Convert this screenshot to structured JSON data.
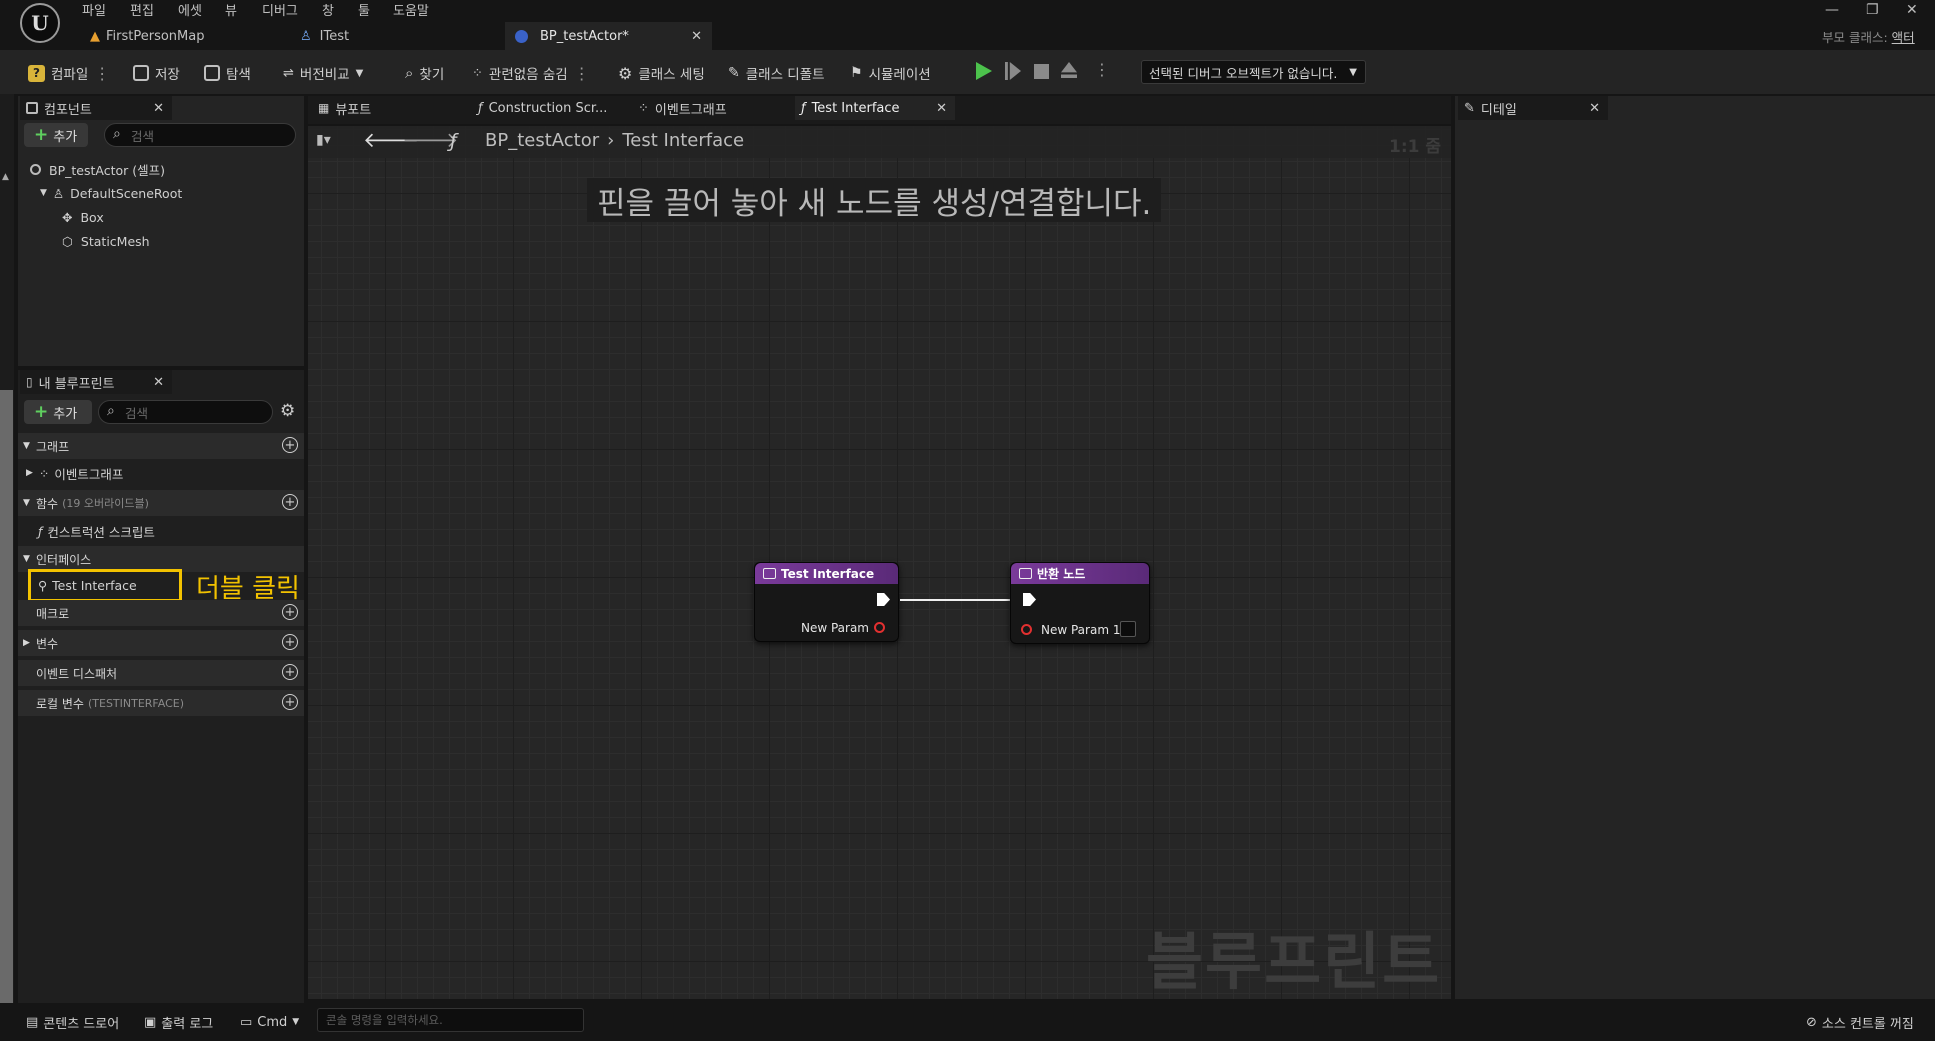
{
  "menu": [
    "파일",
    "편집",
    "에셋",
    "뷰",
    "디버그",
    "창",
    "툴",
    "도움말"
  ],
  "doc_tabs": [
    "FirstPersonMap",
    "ITest",
    "BP_testActor*"
  ],
  "parent_class": {
    "label": "부모 클래스:",
    "value": "액터"
  },
  "toolbar": {
    "compile": "컴파일",
    "save": "저장",
    "browse": "탐색",
    "diff": "버전비교",
    "find": "찾기",
    "hide_unrelated": "관련없음 숨김",
    "class_settings": "클래스 세팅",
    "class_defaults": "클래스 디폴트",
    "simulation": "시뮬레이션",
    "debug_object": "선택된 디버그 오브젝트가 없습니다."
  },
  "components_panel": {
    "title": "컴포넌트",
    "add": "추가",
    "search_placeholder": "검색",
    "tree": [
      "BP_testActor (셀프)",
      "DefaultSceneRoot",
      "Box",
      "StaticMesh"
    ]
  },
  "my_blueprint": {
    "title": "내 블루프린트",
    "add": "추가",
    "search_placeholder": "검색",
    "sections": {
      "graphs": "그래프",
      "event_graph": "이벤트그래프",
      "functions": "함수",
      "functions_note": "(19 오버라이드블)",
      "construction_script": "컨스트럭션 스크립트",
      "interfaces": "인터페이스",
      "test_interface": "Test Interface",
      "macros": "매크로",
      "variables": "변수",
      "event_dispatchers": "이벤트 디스패처",
      "local_vars": "로컬 변수",
      "local_vars_note": "(TESTINTERFACE)"
    }
  },
  "annotation": {
    "label": "더블 클릭",
    "color": "#f2c200"
  },
  "graph_tabs": [
    "뷰포트",
    "Construction Scr...",
    "이벤트그래프",
    "Test Interface"
  ],
  "breadcrumb": {
    "root": "BP_testActor",
    "current": "Test Interface"
  },
  "zoom": "1:1 줌",
  "hint": "핀을 끌어 놓아 새 노드를 생성/연결합니다.",
  "watermark": "블루프린트",
  "nodes": {
    "entry": {
      "title": "Test Interface",
      "pin": "New Param"
    },
    "return": {
      "title": "반환 노드",
      "pin": "New Param 1"
    }
  },
  "details_panel": {
    "title": "디테일"
  },
  "statusbar": {
    "content_drawer": "콘텐츠 드로어",
    "output_log": "출력 로그",
    "cmd": "Cmd",
    "console_placeholder": "콘솔 명령을 입력하세요.",
    "source_control": "소스 컨트롤 꺼짐"
  },
  "colors": {
    "accent_purple": "#7a3a9a",
    "exec_white": "#ffffff",
    "pin_red": "#e23030",
    "play_green": "#4cc24c"
  }
}
